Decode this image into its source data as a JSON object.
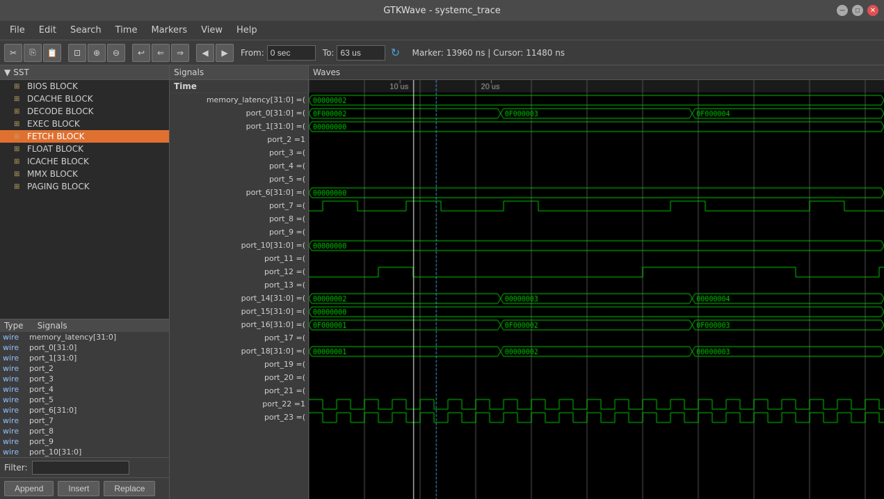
{
  "titlebar": {
    "title": "GTKWave - systemc_trace"
  },
  "menubar": {
    "items": [
      "File",
      "Edit",
      "Search",
      "Time",
      "Markers",
      "View",
      "Help"
    ]
  },
  "toolbar": {
    "from_label": "From:",
    "from_value": "0 sec",
    "to_label": "To:",
    "to_value": "63 us",
    "marker_info": "Marker: 13960 ns  |  Cursor: 11480 ns"
  },
  "sst": {
    "header": "SST",
    "items": [
      {
        "label": "BIOS BLOCK",
        "indent": true
      },
      {
        "label": "DCACHE BLOCK",
        "indent": true
      },
      {
        "label": "DECODE BLOCK",
        "indent": true
      },
      {
        "label": "EXEC BLOCK",
        "indent": true
      },
      {
        "label": "FETCH BLOCK",
        "indent": true,
        "selected": true
      },
      {
        "label": "FLOAT BLOCK",
        "indent": true
      },
      {
        "label": "ICACHE BLOCK",
        "indent": true
      },
      {
        "label": "MMX BLOCK",
        "indent": true
      },
      {
        "label": "PAGING BLOCK",
        "indent": true
      }
    ]
  },
  "type_signals": {
    "header_type": "Type",
    "header_signals": "Signals",
    "rows": [
      {
        "type": "wire",
        "name": "memory_latency[31:0]"
      },
      {
        "type": "wire",
        "name": "port_0[31:0]"
      },
      {
        "type": "wire",
        "name": "port_1[31:0]"
      },
      {
        "type": "wire",
        "name": "port_2"
      },
      {
        "type": "wire",
        "name": "port_3"
      },
      {
        "type": "wire",
        "name": "port_4"
      },
      {
        "type": "wire",
        "name": "port_5"
      },
      {
        "type": "wire",
        "name": "port_6[31:0]"
      },
      {
        "type": "wire",
        "name": "port_7"
      },
      {
        "type": "wire",
        "name": "port_8"
      },
      {
        "type": "wire",
        "name": "port_9"
      },
      {
        "type": "wire",
        "name": "port_10[31:0]"
      }
    ]
  },
  "filter": {
    "label": "Filter:",
    "value": ""
  },
  "buttons": {
    "append": "Append",
    "insert": "Insert",
    "replace": "Replace"
  },
  "signals_col": {
    "header": "Signals",
    "time_label": "Time",
    "names": [
      "memory_latency[31:0] =(",
      "port_0[31:0] =(",
      "port_1[31:0] =(",
      "port_2 =1",
      "port_3 =(",
      "port_4 =(",
      "port_5 =(",
      "port_6[31:0] =(",
      "port_7 =(",
      "port_8 =(",
      "port_9 =(",
      "port_10[31:0] =(",
      "port_11 =(",
      "port_12 =(",
      "port_13 =(",
      "port_14[31:0] =(",
      "port_15[31:0] =(",
      "port_16[31:0] =(",
      "port_17 =(",
      "port_18[31:0] =(",
      "port_19 =(",
      "port_20 =(",
      "port_21 =(",
      "port_22 =1",
      "port_23 =("
    ]
  },
  "waves": {
    "header": "Waves",
    "time_markers": [
      "10 us",
      "20 us"
    ],
    "colors": {
      "green": "#00cc00",
      "blue_marker": "#4a9fd4",
      "white_marker": "#ffffff"
    }
  }
}
